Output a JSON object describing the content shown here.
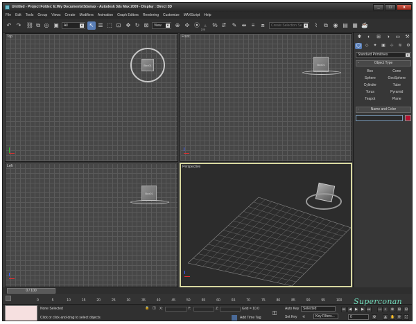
{
  "title": {
    "app_icon": "3dsmax-icon",
    "text": "Untitled    - Project Folder: E:/My Documents/3dsmax    - Autodesk 3ds Max  2009    - Display : Direct 3D"
  },
  "window_buttons": {
    "minimize": "_",
    "maximize": "□",
    "close": "x"
  },
  "menu": [
    "File",
    "Edit",
    "Tools",
    "Group",
    "Views",
    "Create",
    "Modifiers",
    "Animation",
    "Graph Editors",
    "Rendering",
    "Customize",
    "MAXScript",
    "Help"
  ],
  "toolbar": {
    "selection_filter": "All",
    "ref_coord": "View",
    "named_selection": "Create Selection Se",
    "snap_value": "2.5"
  },
  "viewports": {
    "top": {
      "label": "Top",
      "box_text": "Box01"
    },
    "front": {
      "label": "Front",
      "box_text": "Box01"
    },
    "left": {
      "label": "Left",
      "box_text": "Box01"
    },
    "perspective": {
      "label": "Perspective"
    }
  },
  "command_panel": {
    "category": "Standard Primitives",
    "object_type_header": "Object Type",
    "object_buttons": [
      "Box",
      "Cone",
      "Sphere",
      "GeoSphere",
      "Cylinder",
      "Tube",
      "Torus",
      "Pyramid",
      "Teapot",
      "Plane"
    ],
    "name_color_header": "Name and Color",
    "object_color": "#b4102e"
  },
  "timeline": {
    "frame_counter": "0 / 100",
    "ticks": [
      "0",
      "5",
      "10",
      "15",
      "20",
      "25",
      "30",
      "35",
      "40",
      "45",
      "50",
      "55",
      "60",
      "65",
      "70",
      "75",
      "80",
      "85",
      "90",
      "95",
      "100"
    ]
  },
  "status": {
    "selection": "None Selected",
    "prompt": "Click or click-and-drag to select objects",
    "x_label": "X:",
    "y_label": "Y:",
    "z_label": "Z:",
    "grid": "Grid = 10.0",
    "add_time_tag": "Add Time Tag",
    "auto_key": "Auto Key",
    "set_key": "Set Key",
    "key_mode": "Selected",
    "key_filters": "Key Filters...",
    "current_frame": "0"
  },
  "watermark": "Superconan"
}
